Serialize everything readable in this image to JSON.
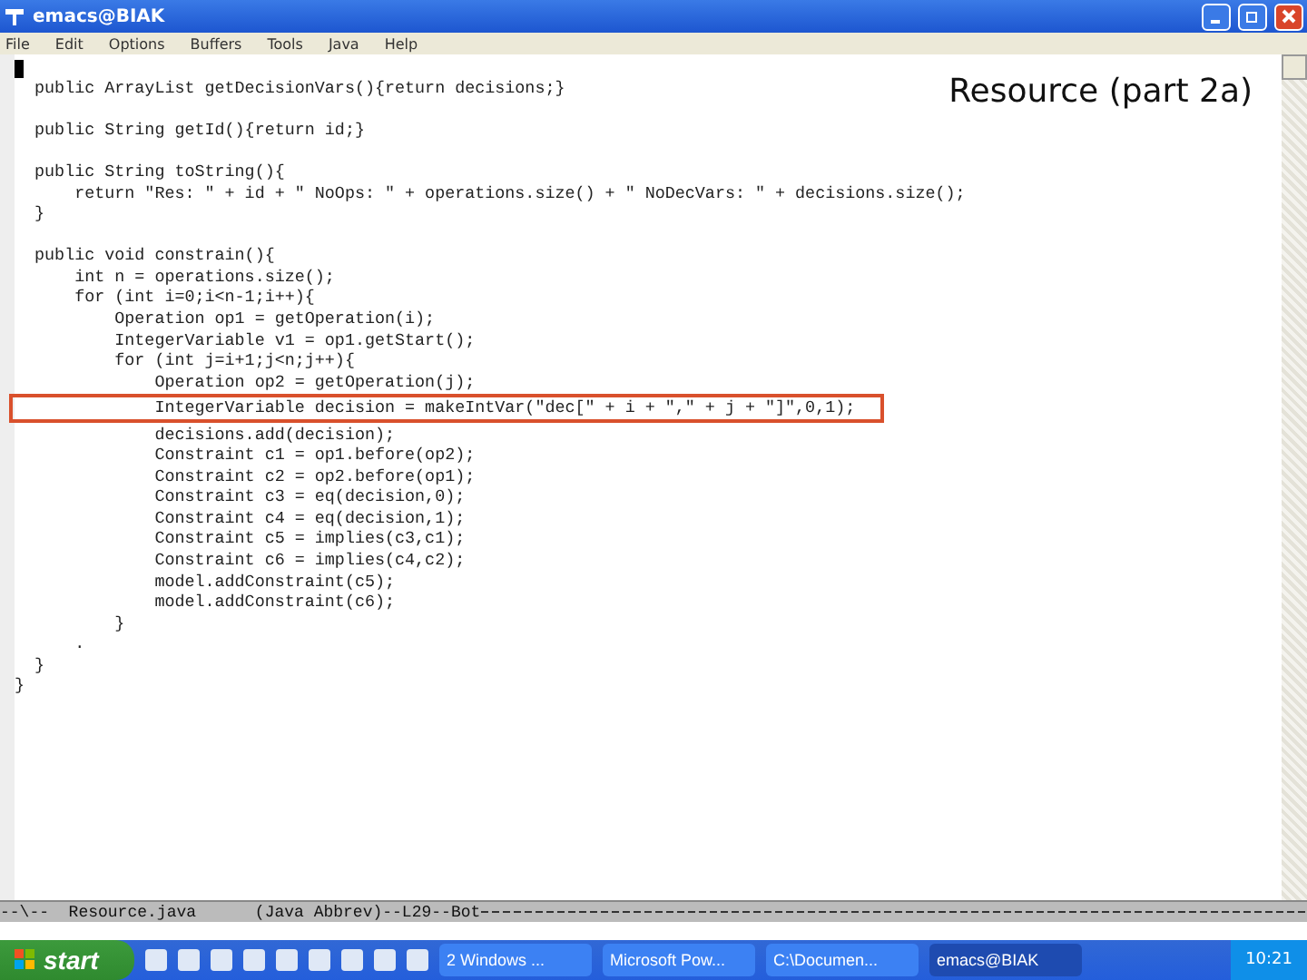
{
  "window": {
    "title": "emacs@BIAK"
  },
  "menu": [
    "File",
    "Edit",
    "Options",
    "Buffers",
    "Tools",
    "Java",
    "Help"
  ],
  "slide_title": "Resource (part 2a)",
  "code_lines": [
    {
      "text": "  public ArrayList getDecisionVars(){return decisions;}",
      "highlighted": false,
      "blank_line_after": true
    },
    {
      "text": "  public String getId(){return id;}",
      "highlighted": false,
      "blank_line_after": true
    },
    {
      "text": "  public String toString(){",
      "highlighted": false
    },
    {
      "text": "      return \"Res: \" + id + \" NoOps: \" + operations.size() + \" NoDecVars: \" + decisions.size();",
      "highlighted": false
    },
    {
      "text": "  }",
      "highlighted": false,
      "blank_line_after": true
    },
    {
      "text": "  public void constrain(){",
      "highlighted": false
    },
    {
      "text": "      int n = operations.size();",
      "highlighted": false
    },
    {
      "text": "      for (int i=0;i<n-1;i++){",
      "highlighted": false
    },
    {
      "text": "          Operation op1 = getOperation(i);",
      "highlighted": false
    },
    {
      "text": "          IntegerVariable v1 = op1.getStart();",
      "highlighted": false
    },
    {
      "text": "          for (int j=i+1;j<n;j++){",
      "highlighted": false
    },
    {
      "text": "              Operation op2 = getOperation(j);",
      "highlighted": false
    },
    {
      "text": "              IntegerVariable decision = makeIntVar(\"dec[\" + i + \",\" + j + \"]\",0,1);",
      "highlighted": true
    },
    {
      "text": "              decisions.add(decision);",
      "highlighted": false
    },
    {
      "text": "              Constraint c1 = op1.before(op2);",
      "highlighted": false
    },
    {
      "text": "              Constraint c2 = op2.before(op1);",
      "highlighted": false
    },
    {
      "text": "              Constraint c3 = eq(decision,0);",
      "highlighted": false
    },
    {
      "text": "              Constraint c4 = eq(decision,1);",
      "highlighted": false
    },
    {
      "text": "              Constraint c5 = implies(c3,c1);",
      "highlighted": false
    },
    {
      "text": "              Constraint c6 = implies(c4,c2);",
      "highlighted": false
    },
    {
      "text": "              model.addConstraint(c5);",
      "highlighted": false
    },
    {
      "text": "              model.addConstraint(c6);",
      "highlighted": false
    },
    {
      "text": "          }",
      "highlighted": false
    },
    {
      "text": "      .",
      "highlighted": false
    },
    {
      "text": "  }",
      "highlighted": false
    },
    {
      "text": "}",
      "highlighted": false
    }
  ],
  "mode_line": "--\\--  Resource.java      (Java Abbrev)--L29--Bot",
  "taskbar": {
    "start": "start",
    "tasks": [
      {
        "label": "2 Windows ...",
        "selected": false
      },
      {
        "label": "Microsoft Pow...",
        "selected": false
      },
      {
        "label": "C:\\Documen...",
        "selected": false
      },
      {
        "label": "emacs@BIAK",
        "selected": true
      }
    ],
    "clock": "10:21"
  }
}
